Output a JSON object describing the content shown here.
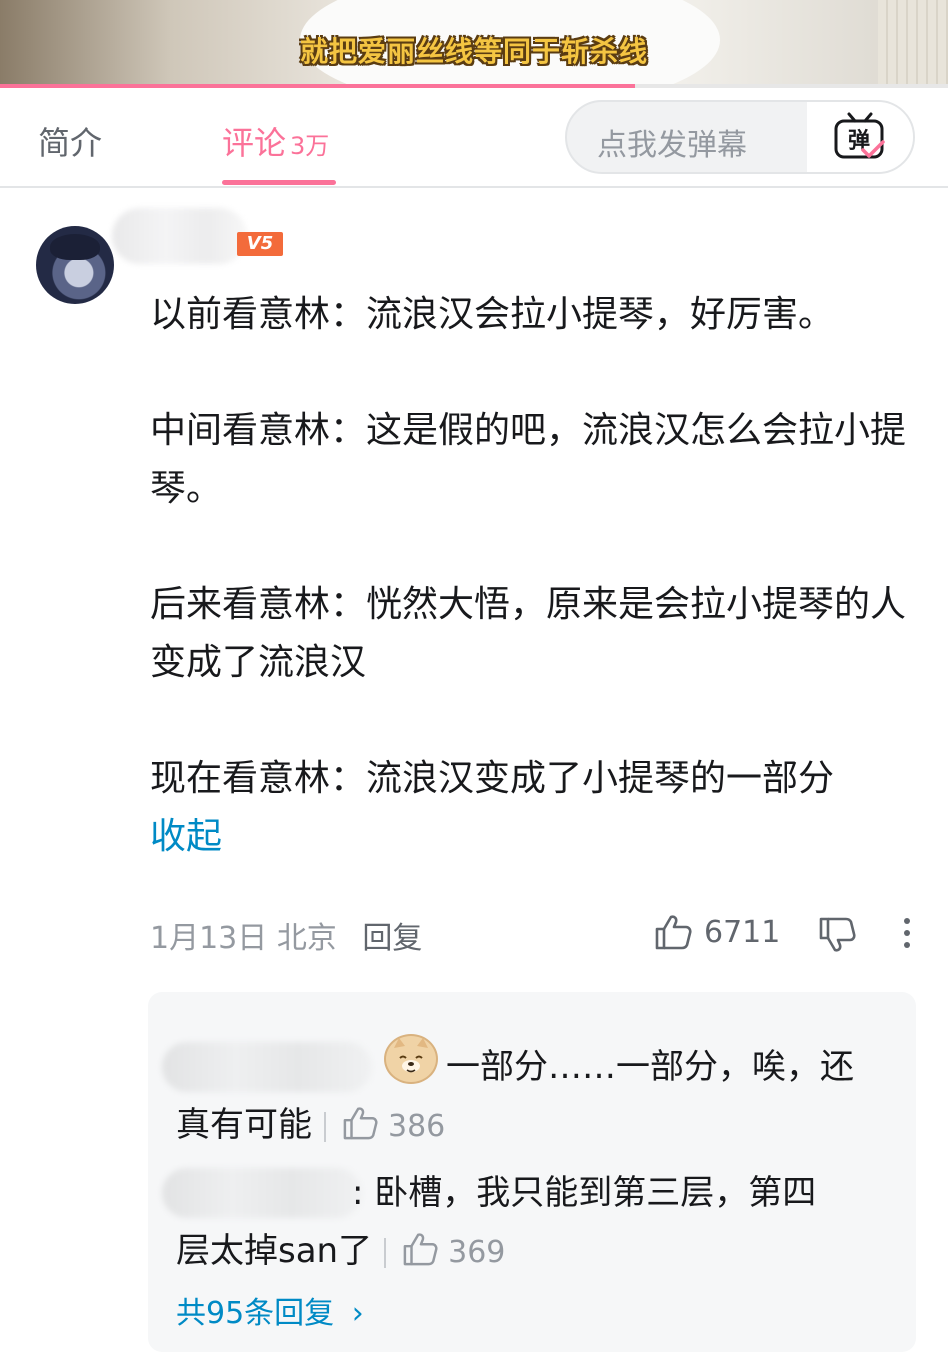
{
  "video": {
    "subtitle": "就把爱丽丝线等同于斩杀线",
    "progress_percent": 67
  },
  "tabs": [
    {
      "label": "简介",
      "active": false
    },
    {
      "label": "评论",
      "count": "3万",
      "active": true
    }
  ],
  "danmaku": {
    "placeholder": "点我发弹幕",
    "button_icon": "danmaku-toggle-icon",
    "button_text": "弹"
  },
  "comment": {
    "level_badge": "V5",
    "paragraphs": [
      "以前看意林：流浪汉会拉小提琴，好厉害。",
      "中间看意林：这是假的吧，流浪汉怎么会拉小提琴。",
      "后来看意林：恍然大悟，原来是会拉小提琴的人变成了流浪汉",
      "现在看意林：流浪汉变成了小提琴的一部分"
    ],
    "collapse_label": "收起",
    "date": "1月13日",
    "location": "北京",
    "reply_label": "回复",
    "likes": "6711"
  },
  "replies": {
    "items": [
      {
        "text_line1": "一部分……一部分，唉，还",
        "text_line2": "真有可能",
        "likes": "386",
        "emoji": "shiba-dog-emoji"
      },
      {
        "text_line1": ": 卧槽，我只能到第三层，第四",
        "text_line2": "层太掉san了",
        "likes": "369"
      }
    ],
    "total_label": "共95条回复",
    "total_arrow": "›"
  },
  "colors": {
    "accent_pink": "#fb7299",
    "link_blue": "#008ac5",
    "level_badge": "#f36b3b"
  }
}
